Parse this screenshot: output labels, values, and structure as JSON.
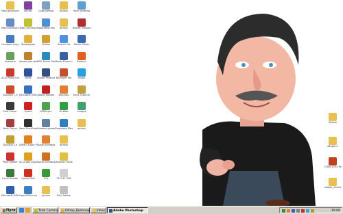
{
  "desktop": {
    "icons": [
      {
        "label": "Мои документы",
        "icon": "folder-icon",
        "color": "#e8c050"
      },
      {
        "label": "Мой компьютер",
        "icon": "computer-icon",
        "color": "#6a8ac8"
      },
      {
        "label": "Сетевое окружение",
        "icon": "network-icon",
        "color": "#4a7ac0"
      },
      {
        "label": "Корзина",
        "icon": "recycle-bin-icon",
        "color": "#6aa060"
      },
      {
        "label": "ACD Photo Editor 3.1",
        "icon": "app-icon",
        "color": "#c83a2a"
      },
      {
        "label": "ACDSee 7.0",
        "icon": "app-icon",
        "color": "#d04a2a"
      },
      {
        "label": "Dvd Player",
        "icon": "app-icon",
        "color": "#3a3a3a"
      },
      {
        "label": "Best Player",
        "icon": "app-icon",
        "color": "#a04040"
      },
      {
        "label": "DivXAlo 2.x",
        "icon": "app-icon",
        "color": "#c0a030"
      },
      {
        "label": "Pixel Master",
        "icon": "app-icon",
        "color": "#d03030"
      },
      {
        "label": "Excel Reader",
        "icon": "app-icon",
        "color": "#3a7a3a"
      },
      {
        "label": "Microsoft Office Outlook",
        "icon": "app-icon",
        "color": "#3060b0"
      },
      {
        "label": "Winrar",
        "icon": "app-icon",
        "color": "#8040a0"
      },
      {
        "label": "Total Commander",
        "icon": "app-icon",
        "color": "#c0c030"
      },
      {
        "label": "Проводник",
        "icon": "app-icon",
        "color": "#e0b040"
      },
      {
        "label": "Архив для фотографий",
        "icon": "app-icon",
        "color": "#c08030"
      },
      {
        "label": "word",
        "icon": "app-icon",
        "color": "#3050a0"
      },
      {
        "label": "Microsoft Office FrontPage",
        "icon": "app-icon",
        "color": "#3a70c0"
      },
      {
        "label": "Opera",
        "icon": "app-icon",
        "color": "#d02020"
      },
      {
        "label": "Nero StartSmart",
        "icon": "app-icon",
        "color": "#303030"
      },
      {
        "label": "AIMP2 Audio Player",
        "icon": "app-icon",
        "color": "#e08020"
      },
      {
        "label": "AC Audio player",
        "icon": "app-icon",
        "color": "#e0a020"
      },
      {
        "label": "Opera Mini",
        "icon": "app-icon",
        "color": "#d03020"
      },
      {
        "label": "OpenOffice.org 3.0",
        "icon": "app-icon",
        "color": "#3a80c0"
      },
      {
        "label": "Спектайзер",
        "icon": "app-icon",
        "color": "#80a0c0"
      },
      {
        "label": "ВидеоМастер",
        "icon": "app-icon",
        "color": "#5090d0"
      },
      {
        "label": "Плеер",
        "icon": "app-icon",
        "color": "#d0a030"
      },
      {
        "label": "BSG Home Player",
        "icon": "app-icon",
        "color": "#2a8ac0"
      },
      {
        "label": "Adobe Photoshop",
        "icon": "app-icon",
        "color": "#305080"
      },
      {
        "label": "Adobe Reader",
        "icon": "app-icon",
        "color": "#c02020"
      },
      {
        "label": "KMPlayer",
        "icon": "app-icon",
        "color": "#50a050"
      },
      {
        "label": "Клавиатурный тренажер",
        "icon": "app-icon",
        "color": "#6080a0"
      },
      {
        "label": "Avast Антивирус",
        "icon": "app-icon",
        "color": "#e08030"
      },
      {
        "label": "Avast Антивирус 2",
        "icon": "app-icon",
        "color": "#d07020"
      },
      {
        "label": "ICQ",
        "icon": "app-icon",
        "color": "#3a9a3a"
      },
      {
        "label": "ярлык",
        "icon": "folder-icon",
        "color": "#e8c050"
      },
      {
        "label": "ярлык",
        "icon": "folder-icon",
        "color": "#e8c050"
      },
      {
        "label": "ярлык",
        "icon": "folder-icon",
        "color": "#e8c050"
      },
      {
        "label": "Search Go",
        "icon": "app-icon",
        "color": "#5090e0"
      },
      {
        "label": "Media Player Classic",
        "icon": "app-icon",
        "color": "#3a60a0"
      },
      {
        "label": "BSPlayer Pro",
        "icon": "app-icon",
        "color": "#c05030"
      },
      {
        "label": "WinAmp",
        "icon": "app-icon",
        "color": "#e08030"
      },
      {
        "label": "Dr.Web",
        "icon": "app-icon",
        "color": "#30a040"
      },
      {
        "label": "Download Master",
        "icon": "app-icon",
        "color": "#3080c0"
      },
      {
        "label": "ярлык",
        "icon": "folder-icon",
        "color": "#e8c050"
      },
      {
        "label": "Daemon Tools",
        "icon": "app-icon",
        "color": "#e0c040"
      },
      {
        "label": "111111.PSD",
        "icon": "file-icon",
        "color": "#d0d0d0"
      },
      {
        "label": "Port Adobe",
        "icon": "file-icon",
        "color": "#c0c0c0"
      },
      {
        "label": "Inter Wireless",
        "icon": "app-icon",
        "color": "#60a0d0"
      },
      {
        "label": "Bitsoft Firewall",
        "icon": "app-icon",
        "color": "#b03030"
      },
      {
        "label": "Movie Maker",
        "icon": "app-icon",
        "color": "#3a6ab0"
      },
      {
        "label": "Radmin",
        "icon": "app-icon",
        "color": "#e06020"
      },
      {
        "label": "Skype",
        "icon": "app-icon",
        "color": "#2aa0e0"
      },
      {
        "label": "Easy Scanner",
        "icon": "app-icon",
        "color": "#c0a040"
      },
      {
        "label": "Images",
        "icon": "app-icon",
        "color": "#40a070"
      },
      {
        "label": "ярлык",
        "icon": "folder-icon",
        "color": "#e8c050"
      }
    ],
    "right_icons": [
      {
        "label": "Ярлык",
        "icon": "folder-icon",
        "color": "#e8c050"
      },
      {
        "label": "88 фото",
        "icon": "folder-icon",
        "color": "#e8c050"
      },
      {
        "label": "1280x1024 Touch Pro",
        "icon": "app-icon",
        "color": "#c04020"
      },
      {
        "label": "новые_папки",
        "icon": "folder-icon",
        "color": "#e8c050"
      }
    ]
  },
  "taskbar": {
    "start_label": "Пуск",
    "tasks": [
      {
        "label": "Total Commander 6.54a",
        "icon": "total-commander-icon",
        "active": false
      },
      {
        "label": "Обзор Дополнительно доп..",
        "icon": "explorer-icon",
        "active": false
      },
      {
        "label": "Inbox",
        "icon": "folder-icon",
        "active": false
      },
      {
        "label": "Adobe Photoshop",
        "icon": "photoshop-icon",
        "active": true
      }
    ],
    "clock": "10:06"
  }
}
